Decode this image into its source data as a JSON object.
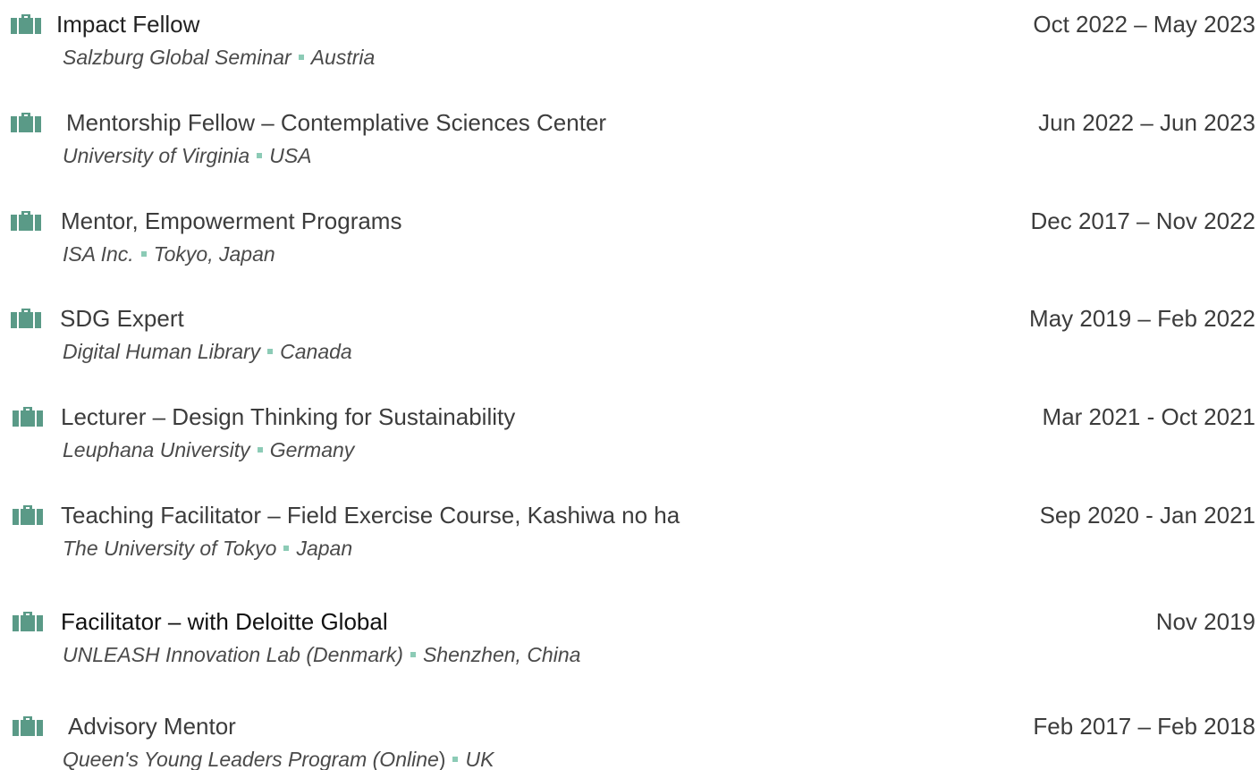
{
  "accent_color": "#5a9a87",
  "separator_color": "#8ccbb6",
  "entries": [
    {
      "title": "Impact Fellow",
      "dates": "Oct 2022 – May 2023",
      "organization": "Salzburg Global Seminar",
      "location": "Austria",
      "icon": "briefcase-icon"
    },
    {
      "title": "Mentorship Fellow – Contemplative Sciences Center",
      "dates": "Jun 2022 – Jun 2023",
      "organization": "University of Virginia",
      "location": "USA",
      "icon": "briefcase-icon"
    },
    {
      "title": "Mentor, Empowerment Programs",
      "dates": "Dec 2017 – Nov 2022",
      "organization": "ISA Inc.",
      "location": "Tokyo, Japan",
      "icon": "briefcase-icon"
    },
    {
      "title": "SDG Expert",
      "dates": "May 2019 – Feb 2022",
      "organization": "Digital Human Library",
      "location": "Canada",
      "icon": "briefcase-icon"
    },
    {
      "title": "Lecturer – Design Thinking for Sustainability",
      "dates": "Mar 2021  - Oct 2021",
      "organization": "Leuphana University",
      "location": "Germany",
      "icon": "briefcase-icon"
    },
    {
      "title": "Teaching Facilitator  – Field Exercise Course, Kashiwa no ha",
      "dates": "Sep 2020 - Jan 2021",
      "organization": "The University of Tokyo",
      "location": "Japan",
      "icon": "briefcase-icon"
    },
    {
      "title": "Facilitator – with Deloitte Global",
      "dates": "Nov 2019",
      "organization": "UNLEASH Innovation Lab (Denmark)",
      "location": "Shenzhen, China",
      "icon": "briefcase-icon"
    },
    {
      "title": "Advisory Mentor",
      "dates": "Feb 2017 – Feb 2018",
      "organization": "Queen's Young Leaders Program (Online",
      "organization_close": ")",
      "location": "UK",
      "icon": "briefcase-icon"
    }
  ]
}
